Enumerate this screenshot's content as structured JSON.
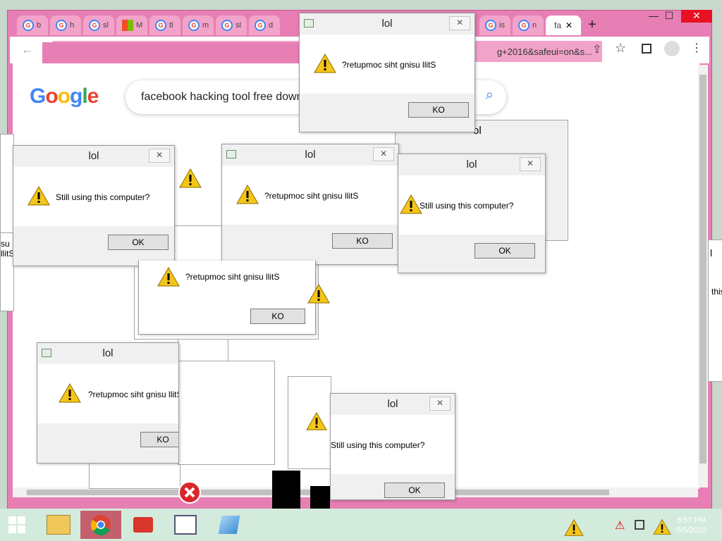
{
  "browser": {
    "tabs": [
      {
        "letter": "G",
        "label": "b"
      },
      {
        "letter": "G",
        "label": "h"
      },
      {
        "letter": "G",
        "label": "sl"
      },
      {
        "letter": "",
        "label": "M"
      },
      {
        "letter": "G",
        "label": "tl"
      },
      {
        "letter": "G",
        "label": "m"
      },
      {
        "letter": "G",
        "label": "sl"
      },
      {
        "letter": "G",
        "label": "d"
      },
      {
        "letter": "G",
        "label": "is"
      },
      {
        "letter": "G",
        "label": "n"
      }
    ],
    "active_tab_label": "fa",
    "url_tail": "g+2016&safeui=on&s...",
    "new_tab": "+",
    "minimize": "—",
    "maximize": "☐",
    "close": "✕",
    "back": "←",
    "star": "☆"
  },
  "google": {
    "logo": "Google",
    "query": "facebook hacking tool free down",
    "search_icon": "search-icon"
  },
  "dialogs": {
    "title": "lol",
    "message_normal": "Still using this computer?",
    "message_reversed": "?retupmoc siht gnisu llitS",
    "ok_normal": "OK",
    "ok_reversed": "KO",
    "close": "✕",
    "fragment_lol": "ol",
    "fragment_this": "this",
    "fragment_su": "su llitS",
    "fragment_l": "l",
    "fragment_tl": "lol"
  },
  "taskbar": {
    "time": "8:57 PM",
    "date": "5/5/2022",
    "ghost_date": "5/5/2022"
  },
  "colors": {
    "browser_frame": "#e77fb4",
    "taskbar": "#d3ebdc",
    "close_red": "#e81123",
    "warning_yellow": "#f5c518"
  }
}
